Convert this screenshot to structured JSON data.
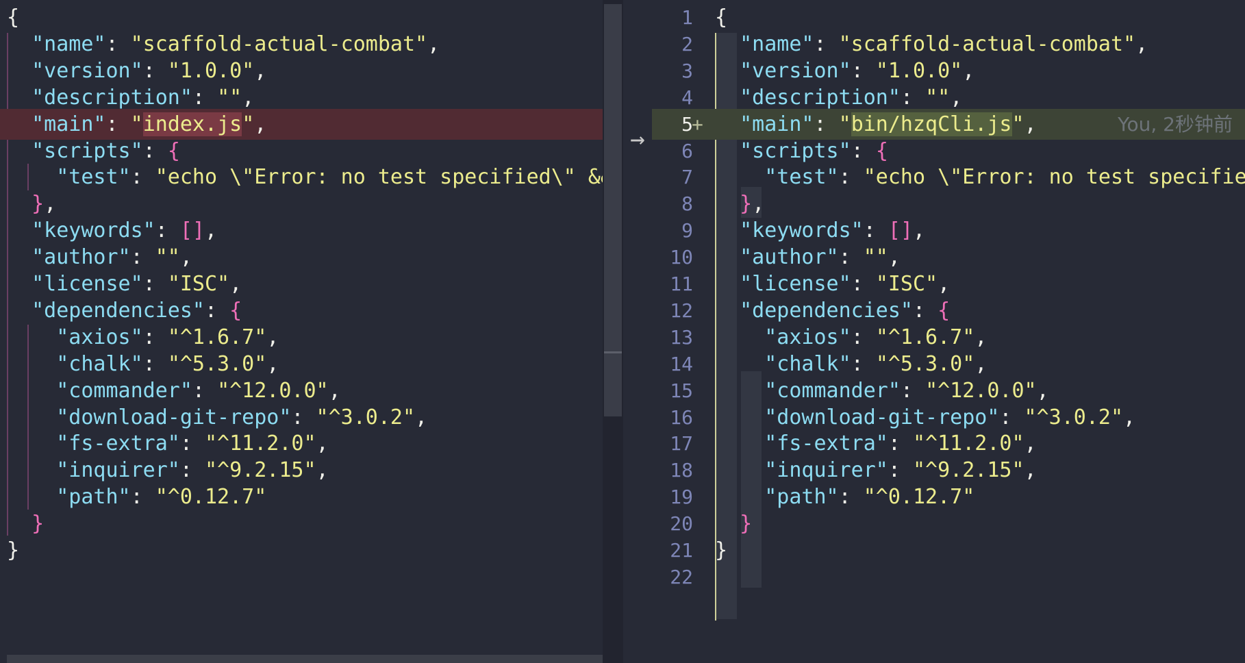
{
  "left": {
    "lines": [
      "{",
      "  \"name\": \"scaffold-actual-combat\",",
      "  \"version\": \"1.0.0\",",
      "  \"description\": \"\",",
      "  \"main\": \"index.js\",",
      "  \"scripts\": {",
      "    \"test\": \"echo \\\"Error: no test specified\\\" && ex",
      "  },",
      "  \"keywords\": [],",
      "  \"author\": \"\",",
      "  \"license\": \"ISC\",",
      "  \"dependencies\": {",
      "    \"axios\": \"^1.6.7\",",
      "    \"chalk\": \"^5.3.0\",",
      "    \"commander\": \"^12.0.0\",",
      "    \"download-git-repo\": \"^3.0.2\",",
      "    \"fs-extra\": \"^11.2.0\",",
      "    \"inquirer\": \"^9.2.15\",",
      "    \"path\": \"^0.12.7\"",
      "  }",
      "}"
    ],
    "removed_line_index": 4,
    "removed_value": "index.js"
  },
  "right": {
    "lines": [
      "{",
      "  \"name\": \"scaffold-actual-combat\",",
      "  \"version\": \"1.0.0\",",
      "  \"description\": \"\",",
      "  \"main\": \"bin/hzqCli.js\",",
      "  \"scripts\": {",
      "    \"test\": \"echo \\\"Error: no test specified",
      "  },",
      "  \"keywords\": [],",
      "  \"author\": \"\",",
      "  \"license\": \"ISC\",",
      "  \"dependencies\": {",
      "    \"axios\": \"^1.6.7\",",
      "    \"chalk\": \"^5.3.0\",",
      "    \"commander\": \"^12.0.0\",",
      "    \"download-git-repo\": \"^3.0.2\",",
      "    \"fs-extra\": \"^11.2.0\",",
      "    \"inquirer\": \"^9.2.15\",",
      "    \"path\": \"^0.12.7\"",
      "  }",
      "}"
    ],
    "line_numbers": [
      "1",
      "2",
      "3",
      "4",
      "5",
      "6",
      "7",
      "8",
      "9",
      "10",
      "11",
      "12",
      "13",
      "14",
      "15",
      "16",
      "17",
      "18",
      "19",
      "20",
      "21",
      "22"
    ],
    "added_line_index": 4,
    "added_value": "bin/hzqCli.js",
    "added_marker": "+",
    "blame": "You, 2秒钟前"
  },
  "diff_arrow": "→",
  "colors": {
    "background": "#272a36",
    "key": "#8ddcf2",
    "string": "#ecec8d",
    "bracket": "#ef6fb8",
    "removed_line": "#512b33",
    "added_line": "#3d4436",
    "line_number": "#7e86b7"
  }
}
